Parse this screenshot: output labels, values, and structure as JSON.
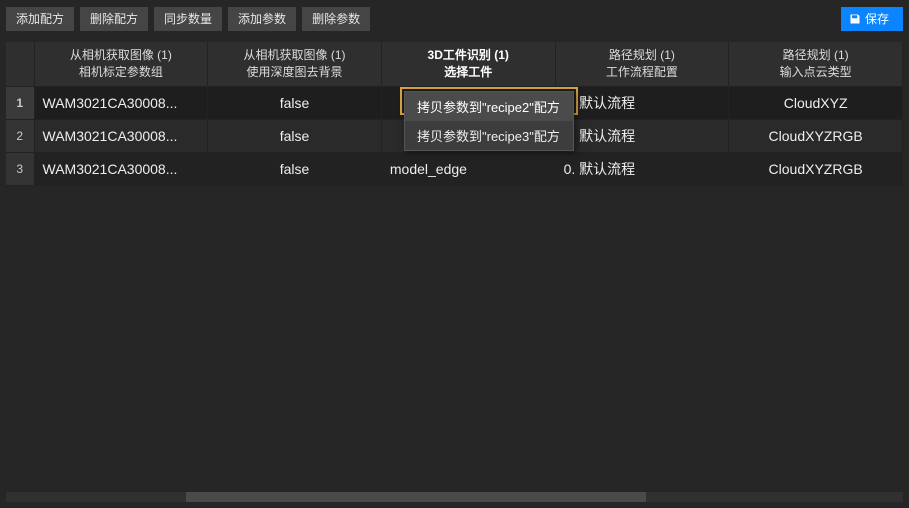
{
  "toolbar": {
    "add_recipe": "添加配方",
    "delete_recipe": "删除配方",
    "sync_count": "同步数量",
    "add_param": "添加参数",
    "delete_param": "删除参数",
    "save": "保存"
  },
  "columns": [
    {
      "group": "从相机获取图像 (1)",
      "sub": "相机标定参数组",
      "current": false
    },
    {
      "group": "从相机获取图像 (1)",
      "sub": "使用深度图去背景",
      "current": false
    },
    {
      "group": "3D工件识别 (1)",
      "sub": "选择工件",
      "current": true
    },
    {
      "group": "路径规划 (1)",
      "sub": "工作流程配置",
      "current": false
    },
    {
      "group": "路径规划 (1)",
      "sub": "输入点云类型",
      "current": false
    }
  ],
  "rows": [
    {
      "idx": "1",
      "cells": [
        "WAM3021CA30008...",
        "false",
        "",
        "0. 默认流程",
        "CloudXYZ"
      ]
    },
    {
      "idx": "2",
      "cells": [
        "WAM3021CA30008...",
        "false",
        "",
        "0. 默认流程",
        "CloudXYZRGB"
      ]
    },
    {
      "idx": "3",
      "cells": [
        "WAM3021CA30008...",
        "false",
        "model_edge",
        "0. 默认流程",
        "CloudXYZRGB"
      ]
    }
  ],
  "context_menu": {
    "items": [
      "拷贝参数到\"recipe2\"配方",
      "拷贝参数到\"recipe3\"配方"
    ],
    "hover_index": 0
  }
}
